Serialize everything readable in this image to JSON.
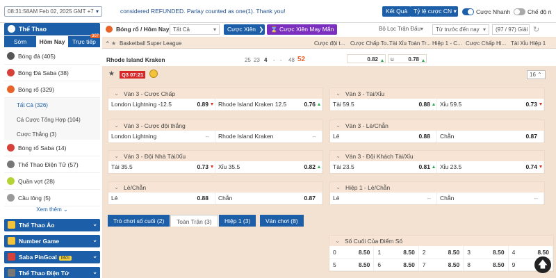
{
  "topbar": {
    "datetime": "08:31:58AM Feb 02, 2025 GMT +7",
    "marquee": "considered REFUNDED. Parlay counted as one(1). Thank you!",
    "results_label": "Kết Quả",
    "odds_type_label": "Tỷ lệ cược CN",
    "quick_bet_label": "Cược Nhanh",
    "mode_label": "Chế độ n"
  },
  "sidebar": {
    "title": "Thể Thao",
    "tabs": [
      "Sớm",
      "Hôm Nay",
      "Trực tiếp"
    ],
    "live_badge": "307",
    "items": [
      {
        "label": "Bóng đá",
        "count": "(405)",
        "icon": "soccer-icon"
      },
      {
        "label": "Bóng Đá Saba",
        "count": "(38)",
        "icon": "soccer-saba-icon"
      },
      {
        "label": "Bóng rổ",
        "count": "(329)",
        "icon": "basketball-icon"
      }
    ],
    "subitems": [
      {
        "label": "Tất Cả",
        "count": "(326)"
      },
      {
        "label": "Cá Cược Tổng Hợp",
        "count": "(104)"
      },
      {
        "label": "Cược Thắng",
        "count": "(3)"
      }
    ],
    "items2": [
      {
        "label": "Bóng rổ Saba",
        "count": "(14)"
      },
      {
        "label": "Thể Thao Điện Tử",
        "count": "(57)"
      },
      {
        "label": "Quần vợt",
        "count": "(28)"
      },
      {
        "label": "Cầu lông",
        "count": "(5)"
      }
    ],
    "more_label": "Xem thêm",
    "categories": [
      {
        "label": "Thể Thao Ảo"
      },
      {
        "label": "Number Game"
      },
      {
        "label": "Saba PinGoal",
        "badge": "Mới"
      },
      {
        "label": "Thể Thao Điện Tử"
      }
    ]
  },
  "filterbar": {
    "breadcrumb": "Bóng rổ / Hôm Nay",
    "all_select": "Tất Cả",
    "parlay_label": "Cược Xiên",
    "lucky_parlay_label": "Cược Xiên May Mắn",
    "match_filter": "Bộ Lọc Trận Đấu",
    "time_sort": "Từ trước đến nay",
    "count_label": "(97 / 97) Giải"
  },
  "columns": {
    "league": "Basketball Super League",
    "c1": "Cược đội t...",
    "c2": "Cược Chấp To...",
    "c3": "Tài Xỉu Toàn Tr...",
    "c4": "Hiệp 1 - C...",
    "c5": "Cược Chấp Hi...",
    "c6": "Tài Xỉu Hiệp 1"
  },
  "match": {
    "team": "Rhode Island Kraken",
    "scores": [
      "25",
      "23",
      "4",
      "-",
      "-",
      "48",
      "52"
    ],
    "odd1": "0.82",
    "u_label": "u",
    "odd2": "0.78",
    "period": "Q3",
    "clock": "07:21",
    "more_count": "16"
  },
  "markets": [
    {
      "title": "Ván 3 - Cược Chấp",
      "left": {
        "label": "London Lightning -12.5",
        "value": "0.89",
        "dir": "down"
      },
      "right": {
        "label": "Rhode Island Kraken 12.5",
        "value": "0.76",
        "dir": "up"
      }
    },
    {
      "title": "Ván 3 - Tài/Xỉu",
      "left": {
        "label": "Tài 59.5",
        "value": "0.88",
        "dir": "up"
      },
      "right": {
        "label": "Xỉu 59.5",
        "value": "0.73",
        "dir": "down"
      }
    },
    {
      "title": "Ván 3 - Cược đội thắng",
      "left": {
        "label": "London Lightning",
        "value": "--",
        "dir": ""
      },
      "right": {
        "label": "Rhode Island Kraken",
        "value": "--",
        "dir": ""
      }
    },
    {
      "title": "Ván 3 - Lẻ/Chẵn",
      "left": {
        "label": "Lẻ",
        "value": "0.88",
        "dir": ""
      },
      "right": {
        "label": "Chẵn",
        "value": "0.87",
        "dir": ""
      }
    },
    {
      "title": "Ván 3 - Đội Nhà Tài/Xỉu",
      "left": {
        "label": "Tài 35.5",
        "value": "0.73",
        "dir": "down"
      },
      "right": {
        "label": "Xỉu 35.5",
        "value": "0.82",
        "dir": "up"
      }
    },
    {
      "title": "Ván 3 - Đội Khách Tài/Xỉu",
      "left": {
        "label": "Tài 23.5",
        "value": "0.81",
        "dir": "up"
      },
      "right": {
        "label": "Xỉu 23.5",
        "value": "0.74",
        "dir": "down"
      }
    },
    {
      "title": "Lẻ/Chẵn",
      "left": {
        "label": "Lẻ",
        "value": "0.88",
        "dir": ""
      },
      "right": {
        "label": "Chẵn",
        "value": "0.87",
        "dir": ""
      }
    },
    {
      "title": "Hiệp 1 - Lẻ/Chẵn",
      "left": {
        "label": "Lẻ",
        "value": "--",
        "dir": ""
      },
      "right": {
        "label": "Chẵn",
        "value": "--",
        "dir": ""
      }
    }
  ],
  "panel_tabs": [
    "Trò chơi số cuối (2)",
    "Toàn Trận (3)",
    "Hiệp 1 (3)",
    "Ván chơi (8)"
  ],
  "last_digit": {
    "title": "Số Cuối Của Điểm Số",
    "cells": [
      {
        "digit": "0",
        "value": "8.50"
      },
      {
        "digit": "1",
        "value": "8.50"
      },
      {
        "digit": "2",
        "value": "8.50"
      },
      {
        "digit": "3",
        "value": "8.50"
      },
      {
        "digit": "4",
        "value": "8.50"
      },
      {
        "digit": "5",
        "value": "8.50"
      },
      {
        "digit": "6",
        "value": "8.50"
      },
      {
        "digit": "7",
        "value": "8.50"
      },
      {
        "digit": "8",
        "value": "8.50"
      },
      {
        "digit": "9",
        "value": "8.50"
      }
    ]
  }
}
